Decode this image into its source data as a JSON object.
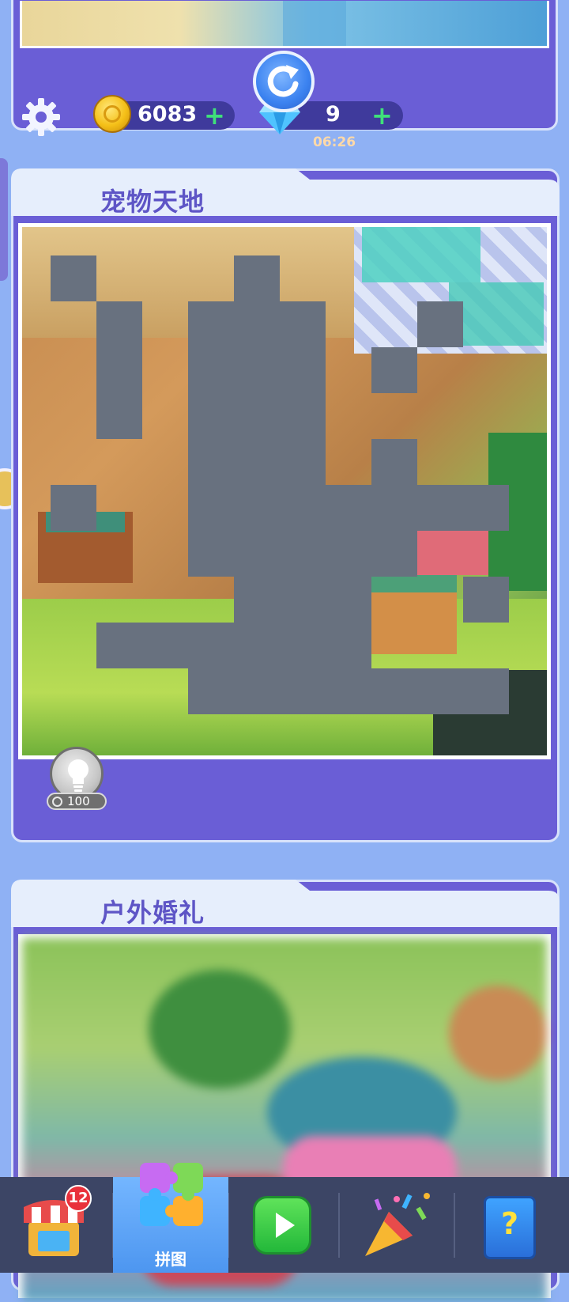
{
  "resources": {
    "coins": "6083",
    "coins_add": "+",
    "gems": "9",
    "gems_add": "+",
    "timer": "06:26"
  },
  "puzzles": [
    {
      "title": "宠物天地",
      "status": "in-progress",
      "hint_cost": "100"
    },
    {
      "title": "户外婚礼",
      "status": "locked-blurred"
    }
  ],
  "bottom_nav": {
    "shop_badge": "12",
    "active_tab": "puzzle",
    "puzzle_label": "拼图"
  },
  "colors": {
    "background": "#8fb1f4",
    "card": "#6a5ed6",
    "card_header": "#e6eefc",
    "title_text": "#5e55c6",
    "missing_piece": "#68717f",
    "nav_bar": "#3c4565",
    "nav_active": "#5ea6f8"
  },
  "icons": {
    "settings": "gear-icon",
    "coin": "coin-icon",
    "gem": "diamond-icon",
    "refresh": "refresh-icon",
    "hint": "lightbulb-icon",
    "shop": "shop-icon",
    "puzzle": "puzzle-icon",
    "play": "play-icon",
    "event": "party-popper-icon",
    "help": "help-book-icon"
  }
}
